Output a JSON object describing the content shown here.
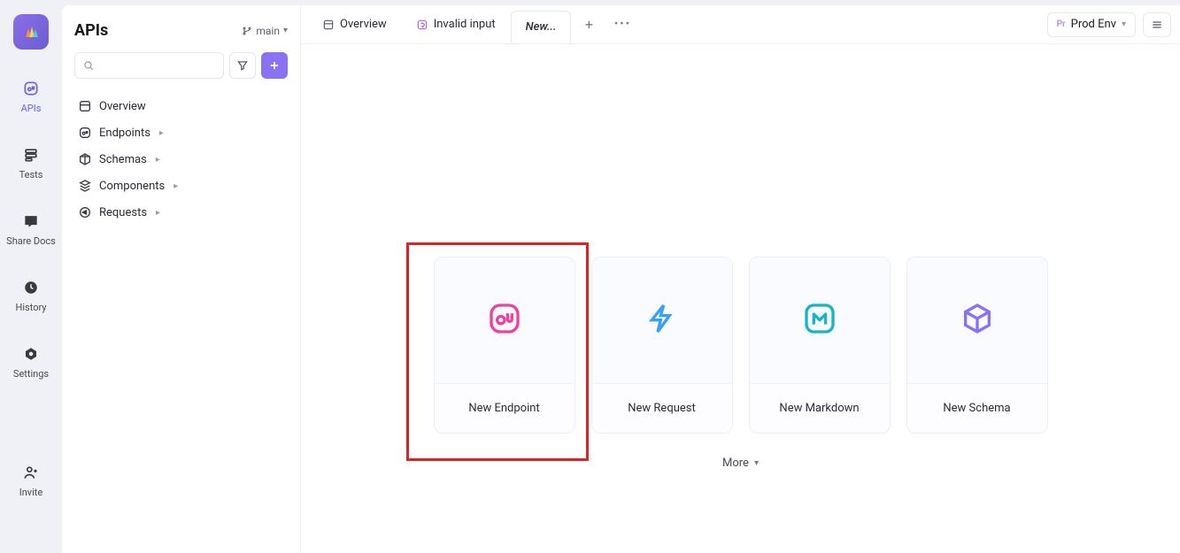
{
  "rail": {
    "items": [
      {
        "label": "APIs"
      },
      {
        "label": "Tests"
      },
      {
        "label": "Share Docs"
      },
      {
        "label": "History"
      },
      {
        "label": "Settings"
      },
      {
        "label": "Invite"
      }
    ]
  },
  "panel": {
    "title": "APIs",
    "branch_label": "main",
    "tree": [
      {
        "label": "Overview"
      },
      {
        "label": "Endpoints"
      },
      {
        "label": "Schemas"
      },
      {
        "label": "Components"
      },
      {
        "label": "Requests"
      }
    ]
  },
  "tabs": {
    "items": [
      {
        "label": "Overview"
      },
      {
        "label": "Invalid input"
      },
      {
        "label": "New..."
      }
    ]
  },
  "env": {
    "tag": "Pr",
    "label": "Prod Env"
  },
  "cards": [
    {
      "label": "New Endpoint"
    },
    {
      "label": "New Request"
    },
    {
      "label": "New Markdown"
    },
    {
      "label": "New Schema"
    }
  ],
  "more_label": "More"
}
